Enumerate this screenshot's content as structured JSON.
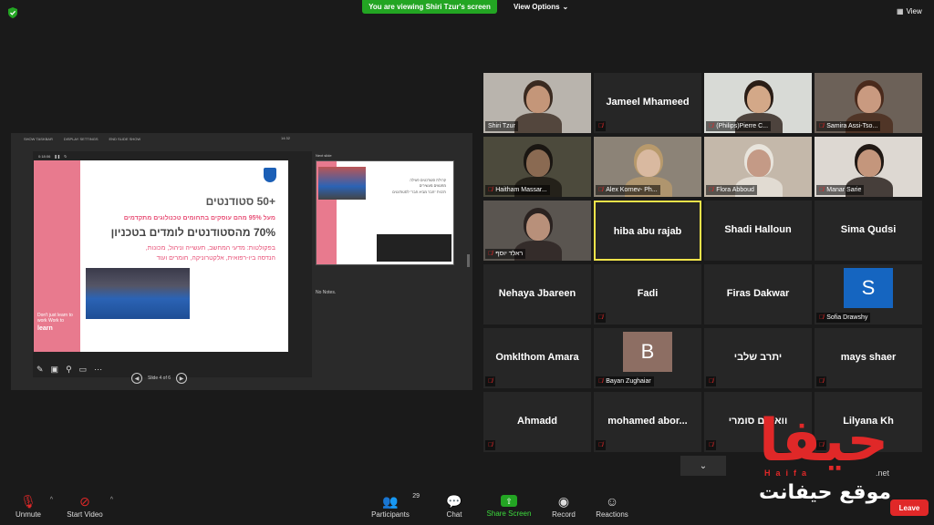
{
  "top_bar": {
    "viewing_banner": "You are viewing Shiri Tzur's screen",
    "view_options": "View Options",
    "view_button": "View"
  },
  "share": {
    "toolbar": [
      "SHOW TASKBAR",
      "DISPLAY SETTINGS",
      "END SLIDE SHOW"
    ],
    "toolbar_time": "14:32",
    "slide_timer": "0:18:06",
    "next_slide_label": "Next slide",
    "notes": "No Notes.",
    "slide_counter": "Slide 4 of 6",
    "slide": {
      "line1": "+50 סטודנטים",
      "line2": "מעל 95% מהם עוסקים בתחומים טכנולוגים מתקדמים",
      "line3": "70% מהסטודנטים לומדים בטכניון",
      "line4": "בפקולטות: מדעי המחשב, תעשייה וניהול, מכונות,",
      "line5": "הנדסה ביו-רפואית, אלקטרוניקה, חומרים ועוד",
      "learn_small": "Don't just learn to work Work to",
      "learn_big": "learn"
    },
    "next_slide_text": [
      "קהילת סטודנטים פעילה",
      "מפגשים מעשירים",
      "תכנית \"חבר מביא חבר\" לסטודנטים"
    ]
  },
  "participants": [
    {
      "name": "Shiri Tzur",
      "type": "video",
      "muted": false,
      "bg": "#b9b4ad",
      "face": "#c49679",
      "hair": "#3a2a20"
    },
    {
      "name": "Jameel Mhameed",
      "type": "name",
      "muted": true
    },
    {
      "name": "(Philips)Pierre C...",
      "type": "video",
      "muted": true,
      "bg": "#d8dad6",
      "face": "#d3a888",
      "hair": "#2a1d16"
    },
    {
      "name": "Samira Assi-Tso...",
      "type": "video",
      "muted": true,
      "bg": "#6c6158",
      "face": "#c99a80",
      "hair": "#4a2a1c"
    },
    {
      "name": "Haitham Massar...",
      "type": "video",
      "muted": true,
      "bg": "#4c4a3c",
      "face": "#8a6a52",
      "hair": "#1a1612"
    },
    {
      "name": "Alex Kornev- Ph...",
      "type": "video",
      "muted": true,
      "bg": "#8c8377",
      "face": "#d9b9a0",
      "hair": "#b89a6c"
    },
    {
      "name": "Flora Abboud",
      "type": "video",
      "muted": true,
      "bg": "#c4b8aa",
      "face": "#c49a86",
      "hair": "#e8e4dc"
    },
    {
      "name": "Manar Sarie",
      "type": "video",
      "muted": true,
      "bg": "#ddd8d2",
      "face": "#c4967c",
      "hair": "#201814"
    },
    {
      "name": "ראלד יוסף",
      "type": "video",
      "muted": true,
      "bg": "#5a5550",
      "face": "#b8907a",
      "hair": "#2a2220"
    },
    {
      "name": "hiba abu rajab",
      "type": "name",
      "muted": false,
      "active": true
    },
    {
      "name": "Shadi Halloun",
      "type": "name",
      "muted": false
    },
    {
      "name": "Sima Qudsi",
      "type": "name",
      "muted": false
    },
    {
      "name": "Nehaya Jbareen",
      "type": "name",
      "muted": false
    },
    {
      "name": "Fadi",
      "type": "name",
      "muted": true
    },
    {
      "name": "Firas Dakwar",
      "type": "name",
      "muted": false
    },
    {
      "name": "Sofia Drawshy",
      "type": "avatar",
      "letter": "S",
      "color": "#1565c0",
      "muted": true
    },
    {
      "name": "Omklthom Amara",
      "type": "name",
      "muted": true
    },
    {
      "name": "Bayan Zughaiar",
      "type": "avatar",
      "letter": "B",
      "color": "#8d6e63",
      "muted": true
    },
    {
      "name": "יתרב שלבי",
      "type": "name",
      "muted": true
    },
    {
      "name": "mays shaer",
      "type": "name",
      "muted": true
    },
    {
      "name": "Ahmadd",
      "type": "name",
      "muted": true
    },
    {
      "name": "mohamed abor...",
      "type": "name",
      "muted": true
    },
    {
      "name": "וואסים סומרי",
      "type": "name",
      "muted": true
    },
    {
      "name": "Lilyana Kh",
      "type": "name",
      "muted": true
    }
  ],
  "toolbar": {
    "unmute": "Unmute",
    "start_video": "Start Video",
    "participants": "Participants",
    "participants_count": "29",
    "chat": "Chat",
    "share_screen": "Share Screen",
    "record": "Record",
    "reactions": "Reactions",
    "leave": "Leave"
  },
  "watermark": {
    "big": "حيفا",
    "haifa": "Haifa",
    "net": ".net",
    "arabic": "موقع حيفانت"
  },
  "colors": {
    "banner_green": "#23a523",
    "mute_red": "#e02828",
    "active_border": "#f0e34a",
    "slide_pink": "#e87a8e"
  }
}
